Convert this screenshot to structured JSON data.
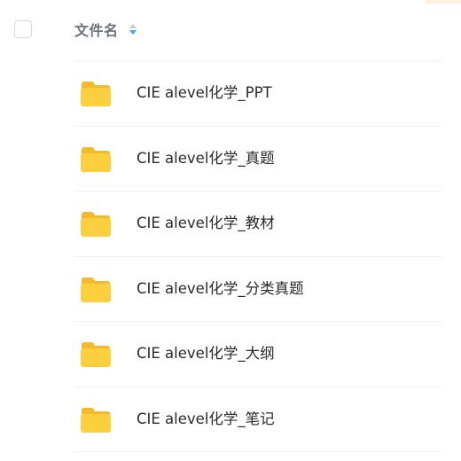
{
  "header": {
    "column_title": "文件名",
    "sort_icon": "sort-arrows-icon"
  },
  "colors": {
    "folder_body": "#FCCF3E",
    "folder_tab": "#F6B92B",
    "sort_active": "#4A9EFF",
    "text_primary": "#2A2A2A",
    "header_text": "#6B7280"
  },
  "files": [
    {
      "name": "CIE alevel化学_PPT",
      "icon": "folder-icon"
    },
    {
      "name": "CIE alevel化学_真题",
      "icon": "folder-icon"
    },
    {
      "name": "CIE alevel化学_教材",
      "icon": "folder-icon"
    },
    {
      "name": "CIE alevel化学_分类真题",
      "icon": "folder-icon"
    },
    {
      "name": "CIE alevel化学_大纲",
      "icon": "folder-icon"
    },
    {
      "name": "CIE alevel化学_笔记",
      "icon": "folder-icon"
    }
  ]
}
